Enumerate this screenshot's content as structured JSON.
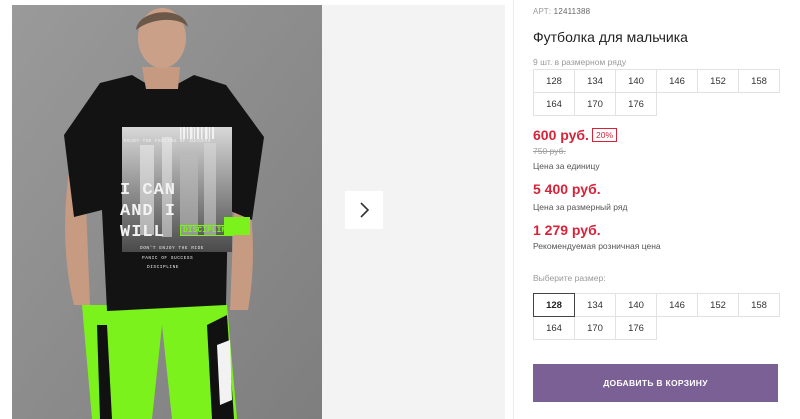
{
  "gallery": {
    "next_icon": "chevron-right-icon",
    "shirt_print": {
      "top_line": "ENJOY THE FEELING OF SUCCESS",
      "big_lines": [
        "I CAN",
        "AND I",
        "WILL"
      ],
      "badge": "DISCIPLINE",
      "small_1": "DON'T ENJOY THE RIDE",
      "small_2": "PANIC OF SUCCESS",
      "small_3": "DISCIPLINE"
    }
  },
  "product": {
    "article_label": "АРТ:",
    "article_value": "12411388",
    "title": "Футболка для мальчика",
    "range_note": "9 шт. в размерном ряду",
    "range_sizes": [
      "128",
      "134",
      "140",
      "146",
      "152",
      "158",
      "164",
      "170",
      "176"
    ],
    "price": "600 руб.",
    "discount": "20%",
    "old_price": "750 руб.",
    "unit_caption": "Цена за единицу",
    "range_price": "5 400 руб.",
    "range_caption": "Цена за размерный ряд",
    "retail_price": "1 279 руб.",
    "retail_caption": "Рекомендуемая розничная цена",
    "choose_label": "Выберите размер:",
    "selectable_sizes": [
      "128",
      "134",
      "140",
      "146",
      "152",
      "158",
      "164",
      "170",
      "176"
    ],
    "selected_size": "128",
    "add_button": "ДОБАВИТЬ В КОРЗИНУ"
  },
  "colors": {
    "accent": "#7b6096",
    "price": "#d6233a",
    "neon_green": "#7cf21c"
  }
}
